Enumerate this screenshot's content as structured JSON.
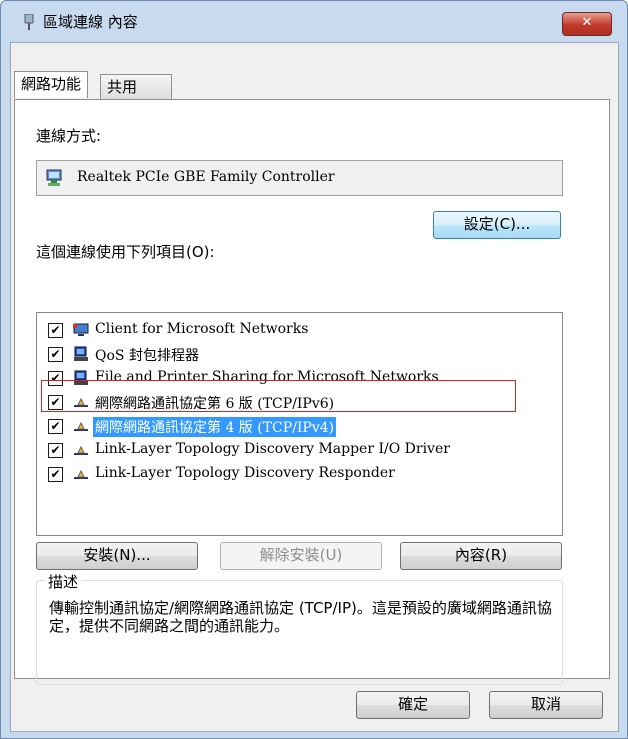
{
  "window": {
    "title": "區域連線 內容",
    "close_label": "✕"
  },
  "tabs": [
    {
      "label": "網路功能"
    },
    {
      "label": "共用"
    }
  ],
  "connect_using": {
    "label": "連線方式:",
    "adapter": "Realtek PCIe GBE Family Controller",
    "configure_button": "設定(C)..."
  },
  "items_section": {
    "label": "這個連線使用下列項目(O):",
    "items": [
      {
        "label": "Client for Microsoft Networks",
        "checked": true,
        "icon": "network-client-icon"
      },
      {
        "label": "QoS 封包排程器",
        "checked": true,
        "icon": "service-icon"
      },
      {
        "label": "File and Printer Sharing for Microsoft Networks",
        "checked": true,
        "icon": "service-icon"
      },
      {
        "label": "網際網路通訊協定第 6 版 (TCP/IPv6)",
        "checked": true,
        "icon": "protocol-icon"
      },
      {
        "label": "網際網路通訊協定第 4 版 (TCP/IPv4)",
        "checked": true,
        "icon": "protocol-icon",
        "selected": true
      },
      {
        "label": "Link-Layer Topology Discovery Mapper I/O Driver",
        "checked": true,
        "icon": "protocol-icon"
      },
      {
        "label": "Link-Layer Topology Discovery Responder",
        "checked": true,
        "icon": "protocol-icon"
      }
    ],
    "check_glyph": "✔"
  },
  "actions": {
    "install": "安裝(N)...",
    "uninstall": "解除安裝(U)",
    "properties": "內容(R)"
  },
  "description": {
    "title": "描述",
    "text": "傳輸控制通訊協定/網際網路通訊協定 (TCP/IP)。這是預設的廣域網路通訊協定，提供不同網路之間的通訊能力。"
  },
  "footer": {
    "ok": "確定",
    "cancel": "取消"
  }
}
